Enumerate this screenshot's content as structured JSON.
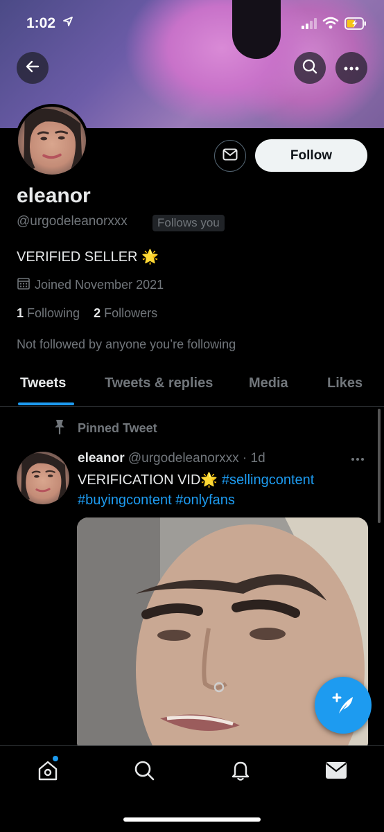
{
  "status_bar": {
    "time": "1:02"
  },
  "profile": {
    "name": "eleanor",
    "handle": "@urgodeleanorxxx",
    "follows_you": "Follows you",
    "bio": "VERIFIED SELLER 🌟",
    "joined": "Joined November 2021",
    "following_count": "1",
    "following_label": "Following",
    "followers_count": "2",
    "followers_label": "Followers",
    "not_followed": "Not followed by anyone you’re following",
    "follow_button": "Follow"
  },
  "tabs": [
    {
      "label": "Tweets",
      "active": true
    },
    {
      "label": "Tweets & replies",
      "active": false
    },
    {
      "label": "Media",
      "active": false
    },
    {
      "label": "Likes",
      "active": false
    }
  ],
  "tweet": {
    "pinned_label": "Pinned Tweet",
    "author": "eleanor",
    "handle": "@urgodeleanorxxx",
    "time": "· 1d",
    "text_prefix": "VERIFICATION VID🌟 ",
    "hashtags": [
      "#sellingcontent",
      "#buyingcontent",
      "#onlyfans"
    ]
  },
  "colors": {
    "accent": "#1d9bf0",
    "background": "#000000",
    "muted": "#71767b"
  },
  "icons": {
    "back": "arrow-left-icon",
    "search": "search-icon",
    "more": "more-icon",
    "mail": "mail-icon",
    "calendar": "calendar-icon",
    "pin": "pin-icon",
    "compose": "compose-icon",
    "home": "home-icon",
    "notifications": "bell-icon",
    "messages": "envelope-icon"
  }
}
